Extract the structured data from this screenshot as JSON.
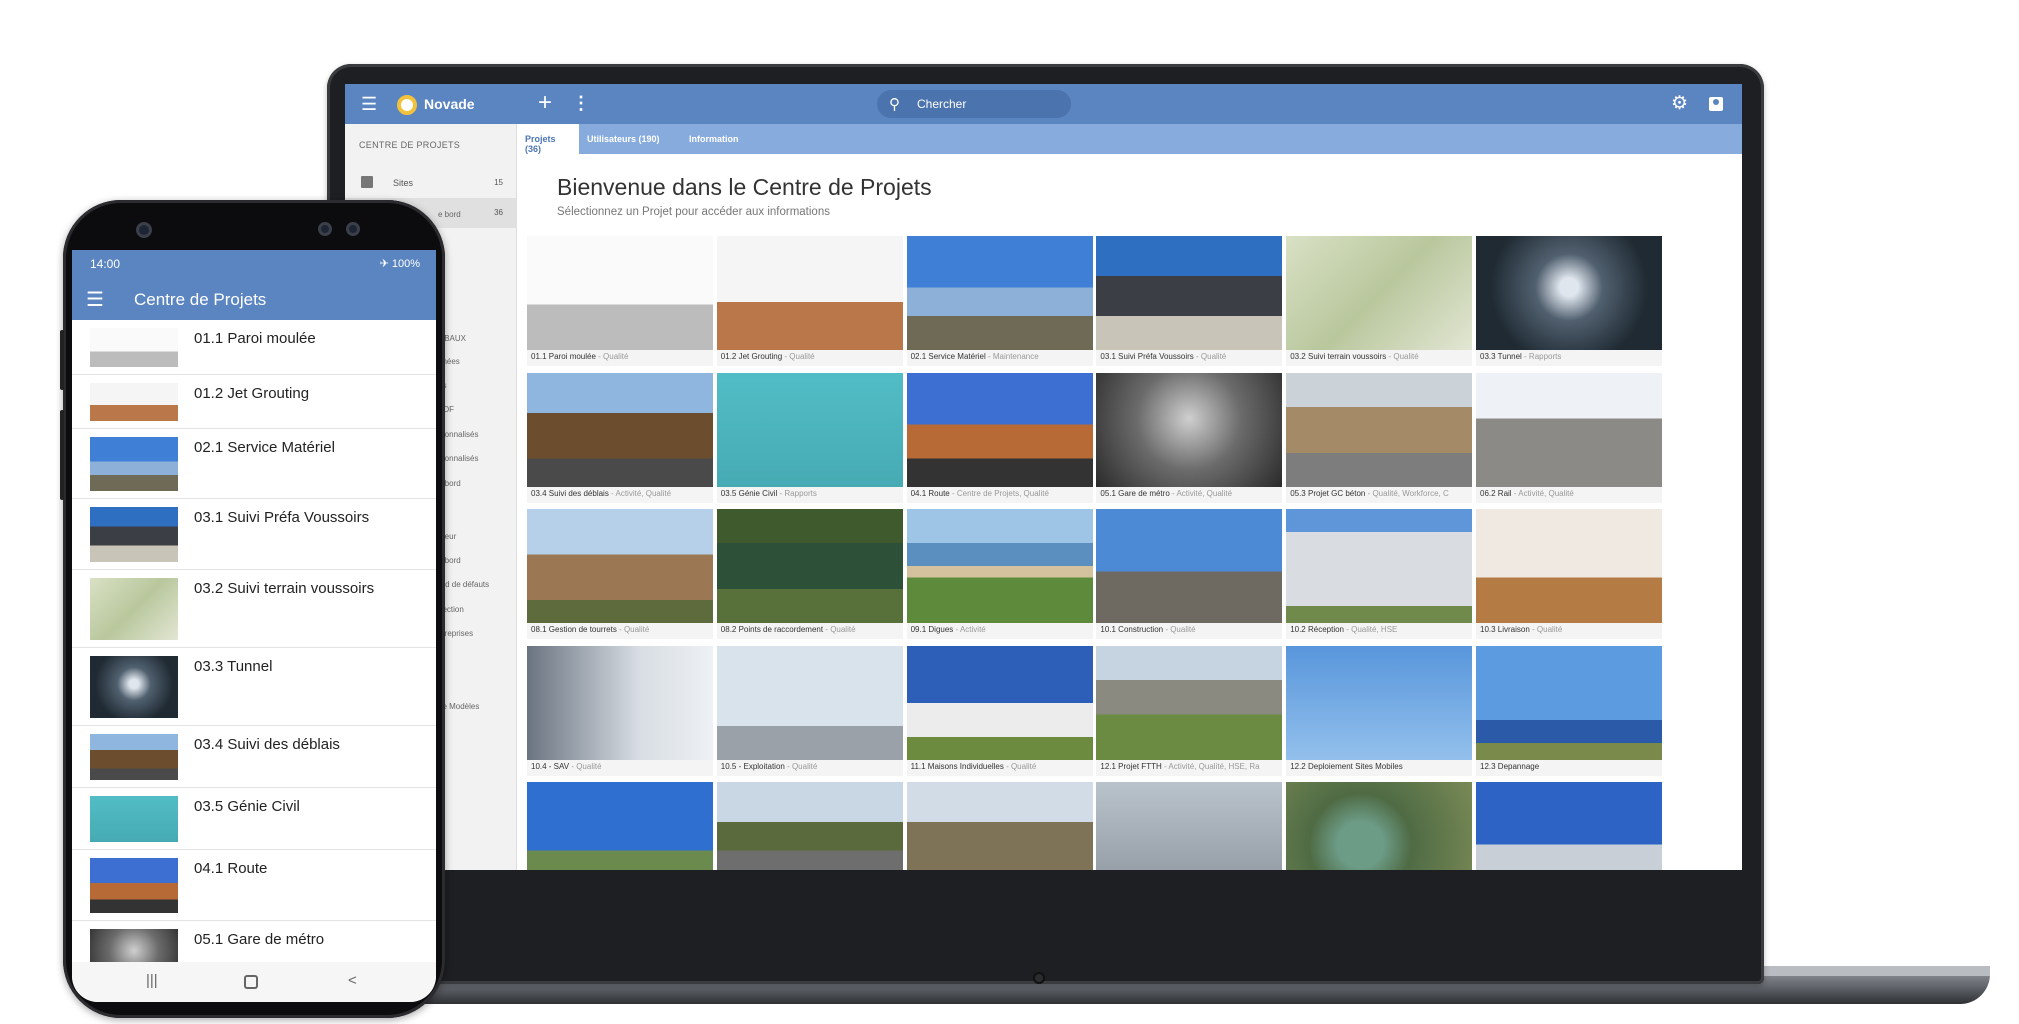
{
  "colors": {
    "brand_blue": "#5a85c1",
    "tab_blue": "#86abdc",
    "logo_yellow": "#f3c23d"
  },
  "laptop": {
    "app_name": "Novade",
    "search": {
      "placeholder": "Chercher"
    },
    "tabs": [
      {
        "label": "Projets (36)",
        "active": true
      },
      {
        "label": "Utilisateurs (190)",
        "active": false
      },
      {
        "label": "Information",
        "active": false
      }
    ],
    "sidebar": {
      "header": "CENTRE DE PROJETS",
      "items": [
        {
          "label": "Sites",
          "count": "15"
        },
        {
          "label": "",
          "count": "36"
        }
      ],
      "visible_fragments": [
        "e bord",
        "OBAUX",
        "nnées",
        "ès",
        "PDF",
        "rsonnalisés",
        "rsonnalisés",
        "e bord",
        "ateur",
        "e bord",
        "ard de défauts",
        "pection",
        "ntreprises",
        "s",
        "de Modèles"
      ]
    },
    "page_title": "Bienvenue dans le Centre de Projets",
    "page_subtitle": "Sélectionnez un Projet pour accéder aux informations",
    "projects": [
      {
        "name": "01.1 Paroi moulée",
        "tags": "Qualité",
        "image": "cranes-diagram"
      },
      {
        "name": "01.2 Jet Grouting",
        "tags": "Qualité",
        "image": "drilling-rigs"
      },
      {
        "name": "02.1 Service Matériel",
        "tags": "Maintenance",
        "image": "yellow-excavator"
      },
      {
        "name": "03.1 Suivi Préfa Voussoirs",
        "tags": "Qualité",
        "image": "precast-factory"
      },
      {
        "name": "03.2 Suivi terrain voussoirs",
        "tags": "Qualité",
        "image": "tunnel-segments"
      },
      {
        "name": "03.3 Tunnel",
        "tags": "Rapports",
        "image": "tunnel"
      },
      {
        "name": "03.4 Suivi des déblais",
        "tags": "Activité, Qualité",
        "image": "earth-piles"
      },
      {
        "name": "03.5 Génie Civil",
        "tags": "Rapports",
        "image": "civil-illustration"
      },
      {
        "name": "04.1 Route",
        "tags": "Centre de Projets, Qualité",
        "image": "desert-road"
      },
      {
        "name": "05.1 Gare de métro",
        "tags": "Activité, Qualité",
        "image": "metro-escalator"
      },
      {
        "name": "05.3 Projet GC béton",
        "tags": "Qualité, Workforce, C",
        "image": "concrete-site"
      },
      {
        "name": "06.2 Rail",
        "tags": "Activité, Qualité",
        "image": "rail-tracks"
      },
      {
        "name": "08.1 Gestion de tourrets",
        "tags": "Qualité",
        "image": "cable-drums"
      },
      {
        "name": "08.2 Points de raccordement",
        "tags": "Qualité",
        "image": "green-cabinet"
      },
      {
        "name": "09.1 Digues",
        "tags": "Activité",
        "image": "dike-aerial"
      },
      {
        "name": "10.1 Construction",
        "tags": "Qualité",
        "image": "building-crane"
      },
      {
        "name": "10.2 Réception",
        "tags": "Qualité, HSE",
        "image": "apartment-building"
      },
      {
        "name": "10.3 Livraison",
        "tags": "Qualité",
        "image": "empty-room"
      },
      {
        "name": "10.4 - SAV",
        "tags": "Qualité",
        "image": "worker-drill"
      },
      {
        "name": "10.5 - Exploitation",
        "tags": "Qualité",
        "image": "glass-tower"
      },
      {
        "name": "11.1 Maisons Individuelles",
        "tags": "Qualité",
        "image": "modern-house"
      },
      {
        "name": "12.1 Projet FTTH",
        "tags": "Activité, Qualité, HSE, Ra",
        "image": "fiber-field"
      },
      {
        "name": "12.2 Deploiement Sites Mobiles",
        "tags": "",
        "image": "telecom-mast"
      },
      {
        "name": "12.3 Depannage",
        "tags": "",
        "image": "crane-truck"
      },
      {
        "name": "",
        "tags": "",
        "image": "bucket-lift"
      },
      {
        "name": "",
        "tags": "",
        "image": "road-sidewalk"
      },
      {
        "name": "",
        "tags": "",
        "image": "housing-site"
      },
      {
        "name": "",
        "tags": "",
        "image": "power-lines"
      },
      {
        "name": "",
        "tags": "",
        "image": "water-treatment"
      },
      {
        "name": "",
        "tags": "",
        "image": "substation"
      }
    ]
  },
  "phone": {
    "time": "14:00",
    "status_right": "✈ 100%",
    "title": "Centre de Projets",
    "items": [
      {
        "label": "01.1 Paroi moulée",
        "image": "cranes-diagram"
      },
      {
        "label": "01.2 Jet Grouting",
        "image": "drilling-rigs"
      },
      {
        "label": "02.1 Service Matériel",
        "image": "yellow-excavator"
      },
      {
        "label": "03.1 Suivi Préfa Voussoirs",
        "image": "precast-factory"
      },
      {
        "label": "03.2 Suivi terrain voussoirs",
        "image": "tunnel-segments"
      },
      {
        "label": "03.3 Tunnel",
        "image": "tunnel"
      },
      {
        "label": "03.4 Suivi des déblais",
        "image": "earth-piles"
      },
      {
        "label": "03.5 Génie Civil",
        "image": "civil-illustration"
      },
      {
        "label": "04.1 Route",
        "image": "desert-road"
      },
      {
        "label": "05.1 Gare de métro",
        "image": "metro-escalator"
      }
    ]
  }
}
